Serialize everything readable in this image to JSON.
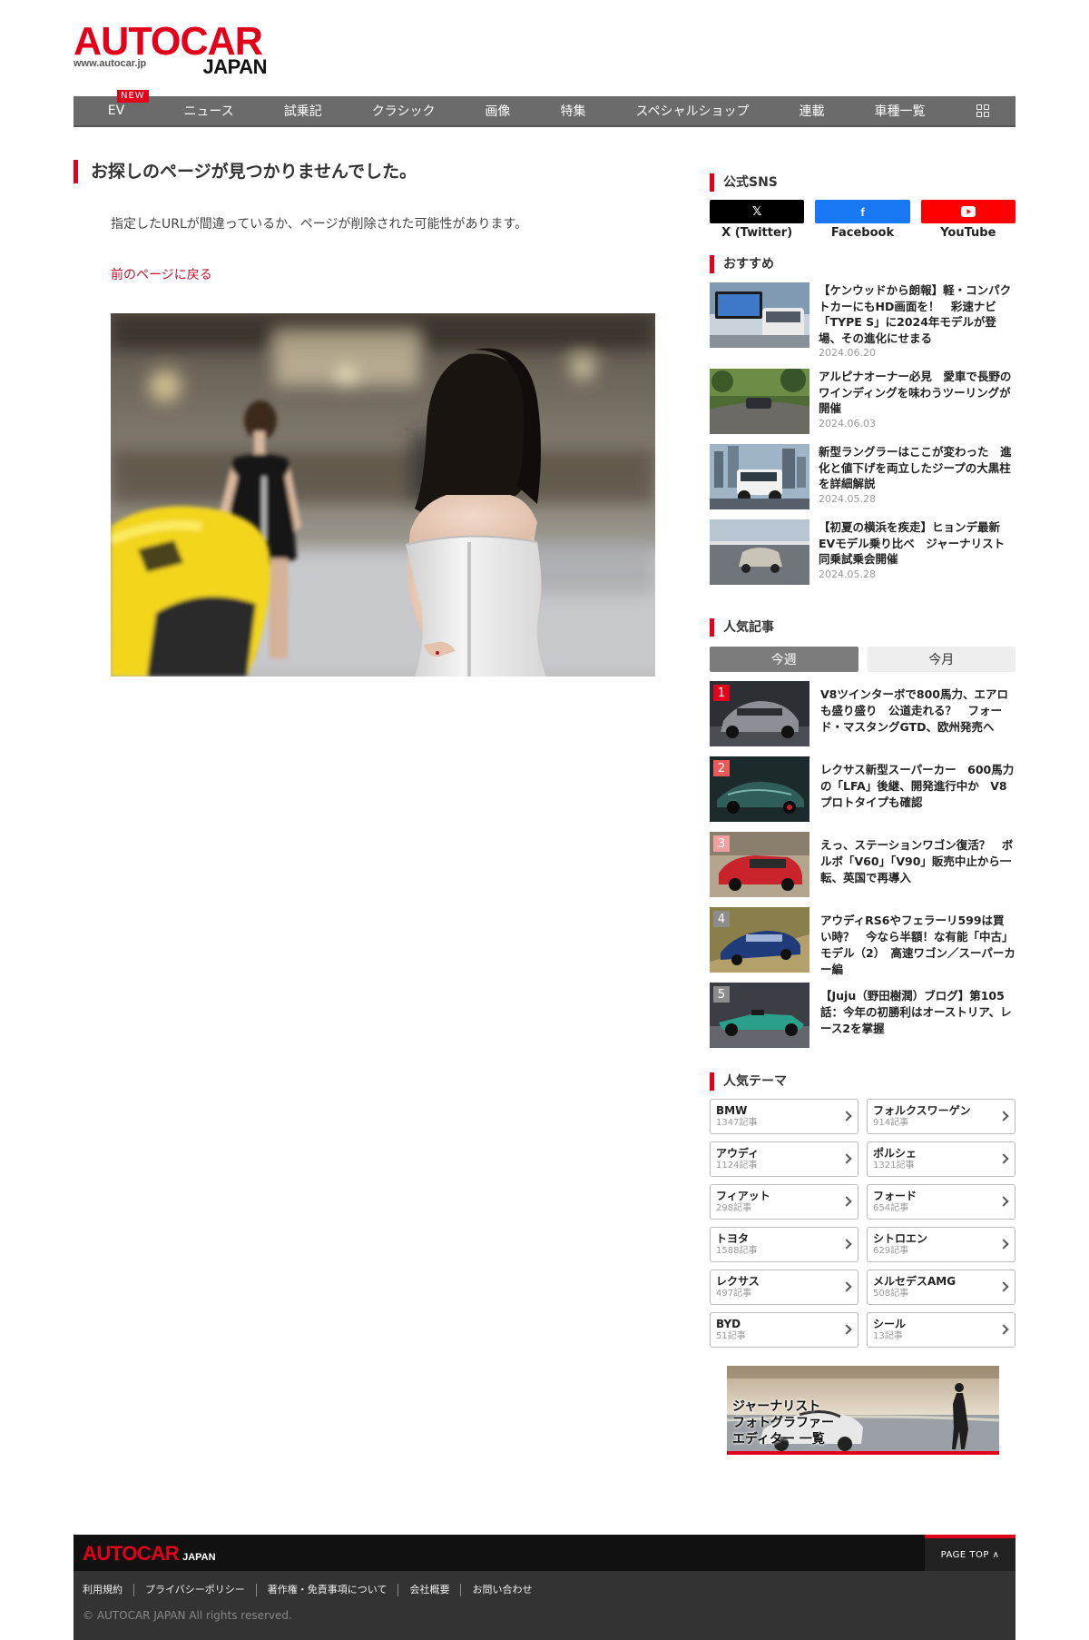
{
  "header": {
    "logo_main": "AUTOCAR",
    "logo_sub": "JAPAN",
    "logo_url": "www.autocar.jp"
  },
  "nav": {
    "items": [
      {
        "label": "EV",
        "badge": "NEW"
      },
      {
        "label": "ニュース"
      },
      {
        "label": "試乗記"
      },
      {
        "label": "クラシック"
      },
      {
        "label": "画像"
      },
      {
        "label": "特集"
      },
      {
        "label": "スペシャルショップ"
      },
      {
        "label": "連載"
      },
      {
        "label": "車種一覧"
      }
    ],
    "grid_icon": "grid-icon"
  },
  "main": {
    "title": "お探しのページが見つかりませんでした。",
    "description": "指定したURLが間違っているか、ページが削除された可能性があります。",
    "back_link": "前のページに戻る"
  },
  "sidebar": {
    "sns_title": "公式SNS",
    "sns": [
      {
        "label": "X (Twitter)",
        "icon": "x-icon",
        "color": "#000000"
      },
      {
        "label": "Facebook",
        "icon": "facebook-icon",
        "color": "#1877f2"
      },
      {
        "label": "YouTube",
        "icon": "youtube-icon",
        "color": "#ff0000"
      }
    ],
    "recommend_title": "おすすめ",
    "recommend": [
      {
        "title": "【ケンウッドから朗報】軽・コンパクトカーにもHD画面を！　彩速ナビ「TYPE S」に2024年モデルが登場、その進化にせまる",
        "date": "2024.06.20"
      },
      {
        "title": "アルピナオーナー必見　愛車で長野のワインディングを味わうツーリングが開催",
        "date": "2024.06.03"
      },
      {
        "title": "新型ラングラーはここが変わった　進化と値下げを両立したジープの大黒柱を詳細解説",
        "date": "2024.05.28"
      },
      {
        "title": "【初夏の横浜を疾走】ヒョンデ最新EVモデル乗り比べ　ジャーナリスト同乗試乗会開催",
        "date": "2024.05.28"
      }
    ],
    "popular_title": "人気記事",
    "tabs": [
      "今週",
      "今月"
    ],
    "ranking": [
      {
        "num": "1",
        "title": "V8ツインターボで800馬力、エアロも盛り盛り　公道走れる？　フォード・マスタングGTD、欧州発売へ"
      },
      {
        "num": "2",
        "title": "レクサス新型スーパーカー　600馬力の「LFA」後継、開発進行中か　V8プロトタイプも確認"
      },
      {
        "num": "3",
        "title": "えっ、ステーションワゴン復活？　ボルボ「V60」「V90」販売中止から一転、英国で再導入"
      },
      {
        "num": "4",
        "title": "アウディRS6やフェラーリ599は買い時？　今なら半額！な有能「中古」モデル（2）　高速ワゴン／スーパーカー編"
      },
      {
        "num": "5",
        "title": "【Juju（野田樹潤）ブログ】第105話：今年の初勝利はオーストリア、レース2を掌握"
      }
    ],
    "theme_title": "人気テーマ",
    "themes": [
      {
        "name": "BMW",
        "count": "1347記事"
      },
      {
        "name": "フォルクスワーゲン",
        "count": "914記事"
      },
      {
        "name": "アウディ",
        "count": "1124記事"
      },
      {
        "name": "ポルシェ",
        "count": "1321記事"
      },
      {
        "name": "フィアット",
        "count": "298記事"
      },
      {
        "name": "フォード",
        "count": "654記事"
      },
      {
        "name": "トヨタ",
        "count": "1588記事"
      },
      {
        "name": "シトロエン",
        "count": "629記事"
      },
      {
        "name": "レクサス",
        "count": "497記事"
      },
      {
        "name": "メルセデスAMG",
        "count": "508記事"
      },
      {
        "name": "BYD",
        "count": "51記事"
      },
      {
        "name": "シール",
        "count": "13記事"
      }
    ],
    "banner_lines": [
      "ジャーナリスト",
      "フォトグラファー",
      "エディター 一覧"
    ]
  },
  "footer": {
    "logo_main": "AUTOCAR",
    "logo_sub": "JAPAN",
    "page_top": "PAGE TOP ∧",
    "links": [
      "利用規約",
      "プライバシーポリシー",
      "著作権・免責事項について",
      "会社概要",
      "お問い合わせ"
    ],
    "copyright": "© AUTOCAR JAPAN All rights reserved."
  },
  "colors": {
    "brand_red": "#e2001a",
    "nav_bg": "#6b6b6b",
    "link_red": "#c0142e",
    "footer_bg": "#333333"
  }
}
